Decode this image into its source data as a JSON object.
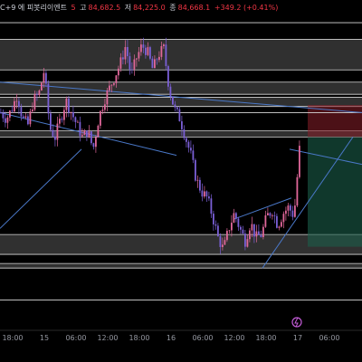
{
  "header": {
    "symbol_tail": "C+9 에 피봇리이엔트",
    "o_label": "5",
    "h_key": "고",
    "h_val": "84,682.5",
    "l_key": "저",
    "l_val": "84,225.0",
    "c_key": "종",
    "c_val": "84,668.1",
    "change": "+349.2 (+0.41%)"
  },
  "colors": {
    "background": "#000000",
    "up": "#e0679a",
    "down": "#7a5fd6",
    "zone": "#6b6b6b",
    "zone_line": "#d9d9d9",
    "trendline": "#4a78c8",
    "stop_zone": "#8a1f2a",
    "target_zone": "#1b5e4a",
    "flash_icon": "#c25bd6"
  },
  "chart_data": {
    "type": "candlestick",
    "x_ticks": [
      "18:00",
      "15",
      "06:00",
      "12:00",
      "18:00",
      "16",
      "06:00",
      "12:00",
      "18:00",
      "17",
      "06:00"
    ],
    "y_range": [
      84000,
      84950
    ],
    "close_path": [
      [
        0,
        84640
      ],
      [
        6,
        84620
      ],
      [
        12,
        84650
      ],
      [
        18,
        84700
      ],
      [
        24,
        84620
      ],
      [
        30,
        84600
      ],
      [
        36,
        84680
      ],
      [
        42,
        84700
      ],
      [
        48,
        84780
      ],
      [
        54,
        84590
      ],
      [
        60,
        84560
      ],
      [
        66,
        84620
      ],
      [
        72,
        84680
      ],
      [
        78,
        84640
      ],
      [
        84,
        84600
      ],
      [
        90,
        84560
      ],
      [
        96,
        84580
      ],
      [
        102,
        84520
      ],
      [
        108,
        84620
      ],
      [
        114,
        84680
      ],
      [
        120,
        84720
      ],
      [
        126,
        84760
      ],
      [
        132,
        84800
      ],
      [
        138,
        84860
      ],
      [
        144,
        84760
      ],
      [
        150,
        84820
      ],
      [
        156,
        84860
      ],
      [
        162,
        84840
      ],
      [
        168,
        84780
      ],
      [
        174,
        84830
      ],
      [
        180,
        84850
      ],
      [
        186,
        84720
      ],
      [
        192,
        84650
      ],
      [
        198,
        84620
      ],
      [
        204,
        84560
      ],
      [
        210,
        84500
      ],
      [
        216,
        84420
      ],
      [
        222,
        84380
      ],
      [
        228,
        84360
      ],
      [
        234,
        84300
      ],
      [
        240,
        84230
      ],
      [
        246,
        84190
      ],
      [
        252,
        84260
      ],
      [
        258,
        84310
      ],
      [
        264,
        84260
      ],
      [
        270,
        84220
      ],
      [
        276,
        84280
      ],
      [
        282,
        84230
      ],
      [
        288,
        84240
      ],
      [
        294,
        84300
      ],
      [
        300,
        84320
      ],
      [
        306,
        84270
      ],
      [
        312,
        84310
      ],
      [
        318,
        84330
      ],
      [
        324,
        84300
      ],
      [
        330,
        84520
      ]
    ],
    "zones": [
      {
        "low": 84780,
        "high": 84880
      },
      {
        "low": 84700,
        "high": 84740
      },
      {
        "low": 84660,
        "high": 84690
      },
      {
        "low": 84560,
        "high": 84580
      },
      {
        "low": 84175,
        "high": 84240
      },
      {
        "low": 84130,
        "high": 84145
      }
    ],
    "lines": [
      84935,
      84640,
      84025
    ],
    "stop_zone": {
      "low": 84560,
      "high": 84665
    },
    "target_zone": {
      "low": 84200,
      "high": 84560
    },
    "stop_target_from_x": 340
  }
}
